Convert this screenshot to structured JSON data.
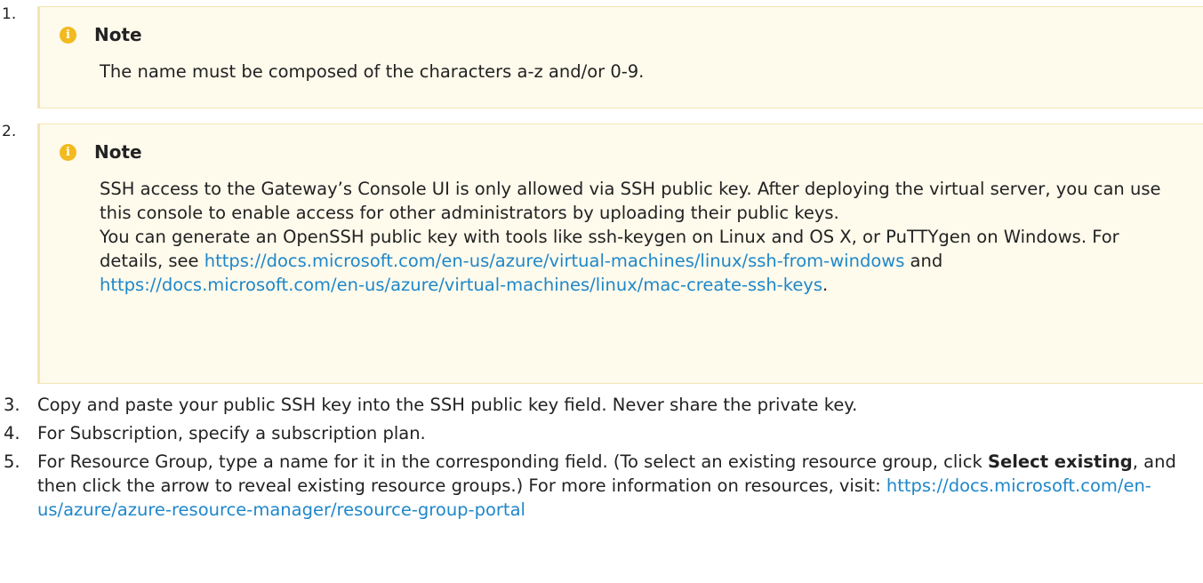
{
  "steps": [
    {
      "number": "1.",
      "note": {
        "title": "Note",
        "icon": "info-icon",
        "text": "The name must be composed of the characters a-z and/or 0-9."
      }
    },
    {
      "number": "2.",
      "note": {
        "title": "Note",
        "icon": "info-icon",
        "para1": "SSH access to the Gateway’s Console UI is only allowed via SSH public key. After deploying the virtual server, you can use this console to enable access for other administrators by uploading their public keys.",
        "para2_pre": "You can generate an OpenSSH public key with tools like ssh-keygen on Linux and OS X, or PuTTYgen on Windows. For details, see ",
        "link1": "https://docs.microsoft.com/en-us/azure/virtual-machines/linux/ssh-from-windows",
        "para2_mid": " and ",
        "link2": "https://docs.microsoft.com/en-us/azure/virtual-machines/linux/mac-create-ssh-keys",
        "para2_post": "."
      }
    },
    {
      "number": "3.",
      "text": "Copy and paste your public SSH key into the SSH public key field. Never share the private key."
    },
    {
      "number": "4.",
      "text": "For Subscription, specify a subscription plan."
    },
    {
      "number": "5.",
      "text_pre": "For Resource Group, type a name for it in the corresponding field. (To select an existing resource group, click ",
      "bold": "Select existing",
      "text_post": ", and then click the arrow to reveal existing resource groups.) For more information on resources, visit: ",
      "link": "https://docs.microsoft.com/en-us/azure/azure-resource-manager/resource-group-portal"
    }
  ],
  "colors": {
    "note_bg": "#fefaec",
    "note_border": "#f3e5b5",
    "note_icon": "#f1ba1f",
    "link": "#1f87c9",
    "text": "#222222"
  }
}
